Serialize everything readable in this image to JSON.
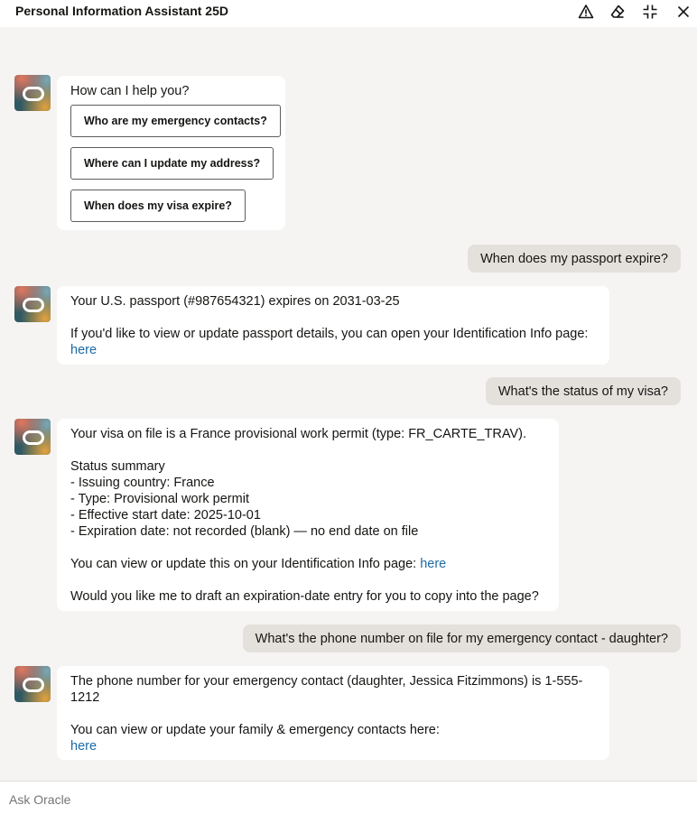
{
  "header": {
    "title": "Personal Information Assistant 25D",
    "icons": [
      "warning-icon",
      "eraser-icon",
      "collapse-icon",
      "close-icon"
    ]
  },
  "messages": {
    "m1": {
      "text": "How can I help you?",
      "suggestions": [
        "Who are my emergency contacts?",
        "Where can I update my address?",
        "When does my visa expire?"
      ]
    },
    "u1": "When does my passport expire?",
    "m2": {
      "line1": "Your U.S. passport (#987654321) expires on 2031-03-25",
      "line2": "If you'd like to view or update passport details, you can open your Identification Info page:",
      "link": "here"
    },
    "u2": "What's the status of my visa?",
    "m3": {
      "line1": "Your visa on file is a France provisional work permit (type: FR_CARTE_TRAV).",
      "summary_title": "Status summary",
      "summary": [
        "- Issuing country: France",
        "- Type: Provisional work permit",
        "- Effective start date: 2025-10-01",
        "- Expiration date: not recorded (blank) — no end date on file"
      ],
      "line_view": "You can view or update this on your Identification Info page:",
      "link": "here",
      "line_last": "Would you like me to draft an expiration-date entry for you to copy into the page?"
    },
    "u3": "What's the phone number on file for my emergency contact - daughter?",
    "m4": {
      "line1a": "The phone number for your emergency contact (daughter, Jessica Fitzimmons) is 1-555-",
      "line1b": "1212",
      "line2": "You can view or update your family & emergency contacts here:",
      "link": "here"
    }
  },
  "composer": {
    "placeholder": "Ask Oracle"
  }
}
